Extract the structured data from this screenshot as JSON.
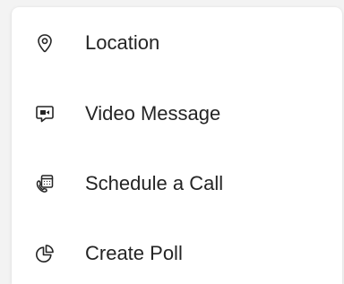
{
  "menu": {
    "items": [
      {
        "label": "Location",
        "icon": "location-pin-icon"
      },
      {
        "label": "Video Message",
        "icon": "video-message-icon"
      },
      {
        "label": "Schedule a Call",
        "icon": "schedule-call-icon"
      },
      {
        "label": "Create Poll",
        "icon": "poll-chart-icon"
      }
    ]
  },
  "colors": {
    "text": "#242424",
    "icon": "#242424",
    "background": "#ffffff",
    "page": "#f3f3f3"
  }
}
